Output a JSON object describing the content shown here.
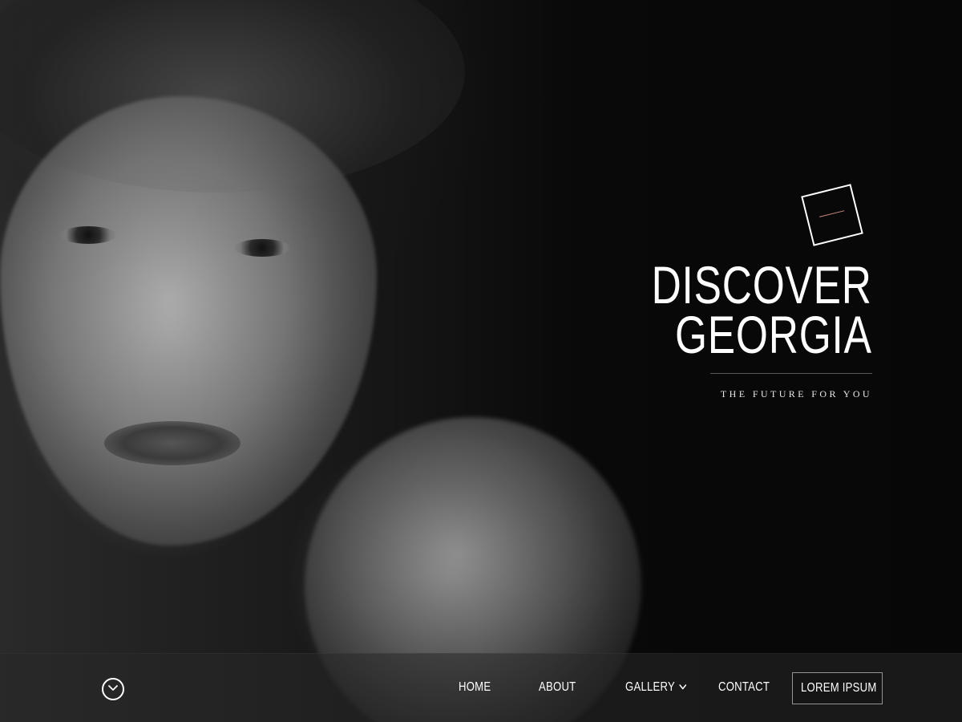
{
  "hero": {
    "image": "black-and-white-portrait",
    "title_line1": "DISCOVER",
    "title_line2": "GEORGIA",
    "tagline": "THE FUTURE FOR YOU"
  },
  "logo": {
    "icon": "rotated-square-logo",
    "accent_color": "#c98a80"
  },
  "nav": {
    "scroll_icon": "chevron-down-circle-icon",
    "items": [
      {
        "label": "HOME"
      },
      {
        "label": "ABOUT"
      },
      {
        "label": "GALLERY",
        "icon": "chevron-down-icon"
      },
      {
        "label": "CONTACT"
      }
    ],
    "button_label": "LOREM IPSUM"
  },
  "colors": {
    "background": "#070707",
    "text": "#ffffff",
    "navbar": "#282828"
  }
}
